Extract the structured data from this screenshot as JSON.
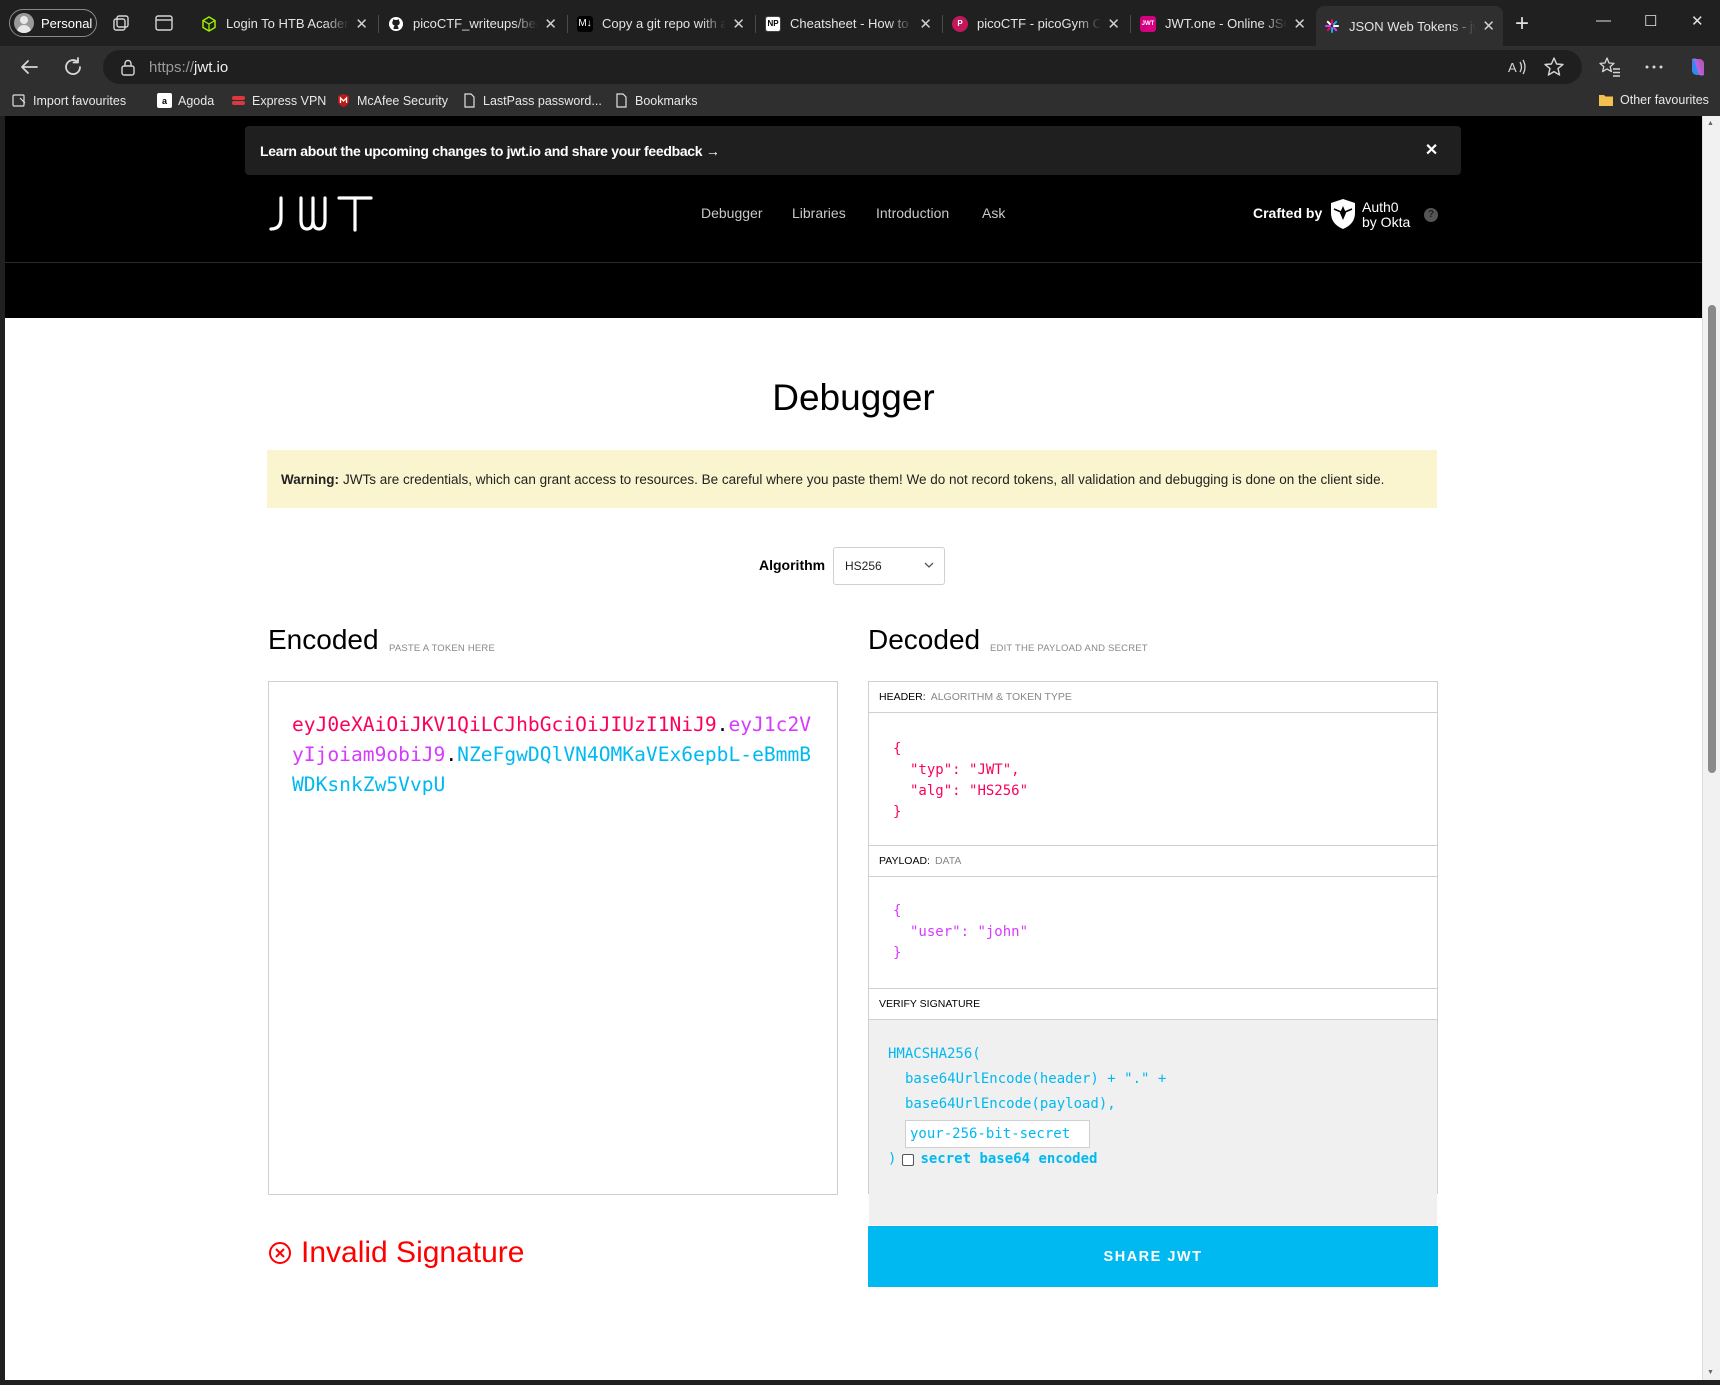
{
  "browser": {
    "profile_label": "Personal",
    "tabs": [
      {
        "label": "Login To HTB Academy",
        "color": "#9fef00"
      },
      {
        "label": "picoCTF_writeups/beginner",
        "color": "#ffffff"
      },
      {
        "label": "Copy a git repo with all",
        "favicon_text": "M↓",
        "color": "#000000"
      },
      {
        "label": "Cheatsheet - How to write",
        "favicon_text": "NP",
        "color": "#ffffff"
      },
      {
        "label": "picoCTF - picoGym Challenges",
        "favicon_text": "P",
        "color": "#c2185b"
      },
      {
        "label": "JWT.one - Online JSON",
        "favicon_text": "JWT",
        "color": "#d5007f"
      },
      {
        "label": "JSON Web Tokens - jwt.io",
        "color": "#e91e63"
      }
    ],
    "url_proto": "https://",
    "url_host": "jwt.io",
    "favourites": [
      {
        "label": "Import favourites",
        "icon": "import-icon"
      },
      {
        "label": "Agoda",
        "favicon_text": "a",
        "color": "#ffffff"
      },
      {
        "label": "Express VPN",
        "icon": "expressvpn-icon",
        "color": "#da3940"
      },
      {
        "label": "McAfee Security",
        "icon": "mcafee-icon",
        "color": "#c01818"
      },
      {
        "label": "LastPass password...",
        "icon": "page-icon"
      },
      {
        "label": "Bookmarks",
        "icon": "page-icon"
      }
    ],
    "other_favourites": "Other favourites"
  },
  "site": {
    "banner_text": "Learn about the upcoming changes to jwt.io and share your feedback →",
    "logo_text": "JWT",
    "nav": [
      "Debugger",
      "Libraries",
      "Introduction",
      "Ask"
    ],
    "crafted_by": "Crafted by",
    "auth0_line1": "Auth0",
    "auth0_line2": "by Okta",
    "help": "?"
  },
  "debugger": {
    "title": "Debugger",
    "warning_label": "Warning:",
    "warning_text": "JWTs are credentials, which can grant access to resources. Be careful where you paste them! We do not record tokens, all validation and debugging is done on the client side.",
    "algorithm_label": "Algorithm",
    "algorithm_value": "HS256",
    "encoded_title": "Encoded",
    "encoded_sub": "PASTE A TOKEN HERE",
    "decoded_title": "Decoded",
    "decoded_sub": "EDIT THE PAYLOAD AND SECRET",
    "token": {
      "header": "eyJ0eXAiOiJKV1QiLCJhbGciOiJIUzI1NiJ9",
      "payload": "eyJ1c2VyIjoiam9obiJ9",
      "signature": "NZeFgwDQlVN4OMKaVEx6epbL-eBmmBWDKsnkZw5VvpU"
    },
    "header_label": "HEADER:",
    "header_sub": "ALGORITHM & TOKEN TYPE",
    "header_json": {
      "typ_key": "\"typ\"",
      "typ_val": "\"JWT\"",
      "alg_key": "\"alg\"",
      "alg_val": "\"HS256\""
    },
    "payload_label": "PAYLOAD:",
    "payload_sub": "DATA",
    "payload_json": {
      "user_key": "\"user\"",
      "user_val": "\"john\""
    },
    "signature_label": "VERIFY SIGNATURE",
    "sig_fn": "HMACSHA256(",
    "sig_line1": "base64UrlEncode(header) + \".\" +",
    "sig_line2": "base64UrlEncode(payload),",
    "secret_placeholder": "your-256-bit-secret",
    "sig_close": ")",
    "b64_label": "secret base64 encoded",
    "status_text": "Invalid Signature",
    "share_label": "SHARE JWT"
  },
  "colors": {
    "header": "#fb015b",
    "payload": "#d63aff",
    "signature": "#00b9f1",
    "error": "#ff0000"
  }
}
